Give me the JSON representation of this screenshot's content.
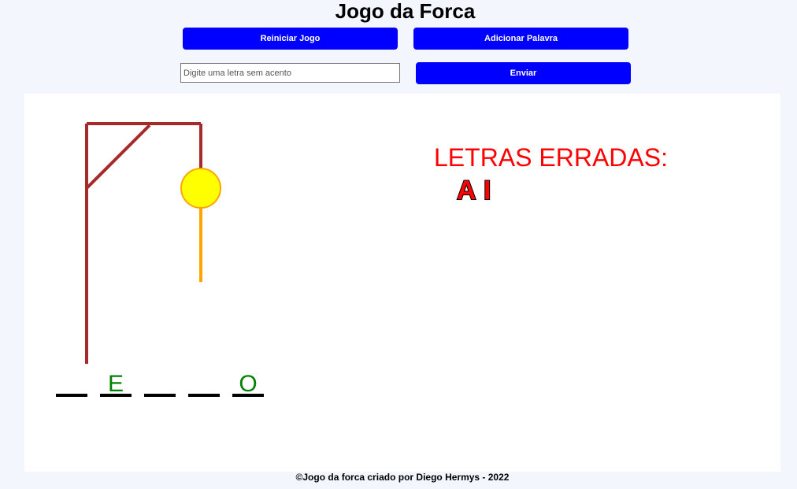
{
  "header": {
    "title": "Jogo da Forca"
  },
  "toolbar": {
    "restart_label": "Reiniciar Jogo",
    "add_word_label": "Adicionar Palavra",
    "submit_label": "Enviar"
  },
  "input": {
    "placeholder": "Digite uma letra sem acento",
    "value": ""
  },
  "game": {
    "wrong_letters_title": "LETRAS ERRADAS:",
    "wrong_letters": [
      "A",
      "I"
    ],
    "word_slots": [
      "",
      "E",
      "",
      "",
      "O"
    ],
    "errors_count": 2
  },
  "colors": {
    "button": "#0000ff",
    "gallows": "#a52a2a",
    "head_fill": "#ffff00",
    "body": "#ffa500",
    "wrong_title": "#ff0000",
    "guessed_letter": "#008000",
    "wrong_letter_fill": "#ff0000"
  },
  "footer": {
    "credits": "©Jogo da forca criado por Diego Hermys - 2022"
  }
}
